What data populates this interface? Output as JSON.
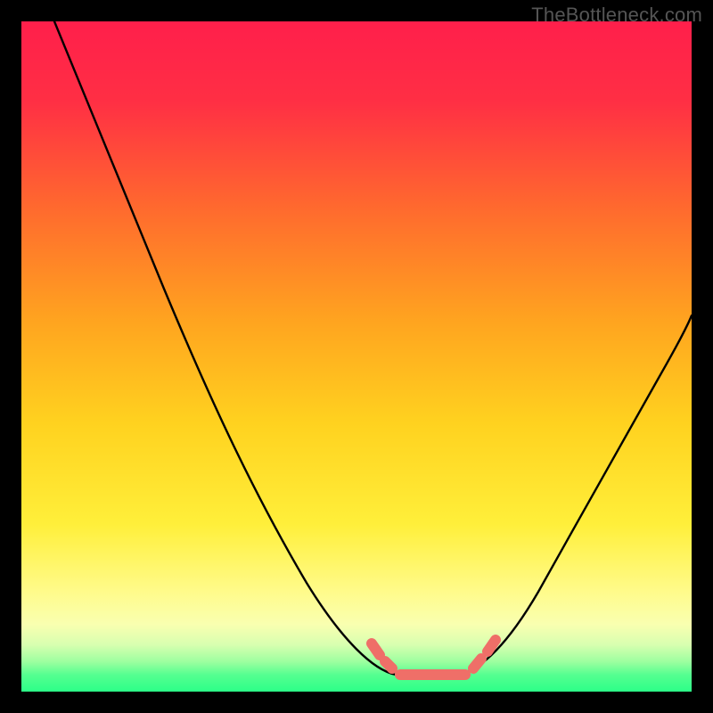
{
  "watermark": {
    "text": "TheBottleneck.com"
  },
  "chart_data": {
    "type": "line",
    "title": "",
    "xlabel": "",
    "ylabel": "",
    "xlim": [
      0,
      100
    ],
    "ylim": [
      0,
      100
    ],
    "grid": false,
    "legend": false,
    "gradient_colors": {
      "top": "#ff1f4b",
      "mid_upper": "#ff7a2a",
      "mid": "#ffd21f",
      "mid_lower": "#fff680",
      "bottom": "#2cff88"
    },
    "series": [
      {
        "name": "bottleneck-curve",
        "color": "#000000",
        "x": [
          5,
          8,
          12,
          16,
          20,
          25,
          30,
          35,
          40,
          45,
          50,
          54,
          57,
          60,
          63,
          66,
          70,
          75,
          80,
          85,
          90,
          95,
          100
        ],
        "y": [
          100,
          92,
          84,
          76,
          68,
          58,
          48,
          38,
          28,
          18,
          10,
          5,
          3,
          3,
          3,
          4,
          8,
          16,
          26,
          36,
          46,
          54,
          60
        ]
      },
      {
        "name": "bottom-marker-left",
        "color": "#ef6f68",
        "x": [
          54,
          56
        ],
        "y": [
          6,
          4
        ]
      },
      {
        "name": "bottom-marker-flat",
        "color": "#ef6f68",
        "x": [
          57,
          66
        ],
        "y": [
          3,
          3
        ]
      },
      {
        "name": "bottom-marker-right",
        "color": "#ef6f68",
        "x": [
          67,
          69
        ],
        "y": [
          5,
          8
        ]
      }
    ]
  }
}
